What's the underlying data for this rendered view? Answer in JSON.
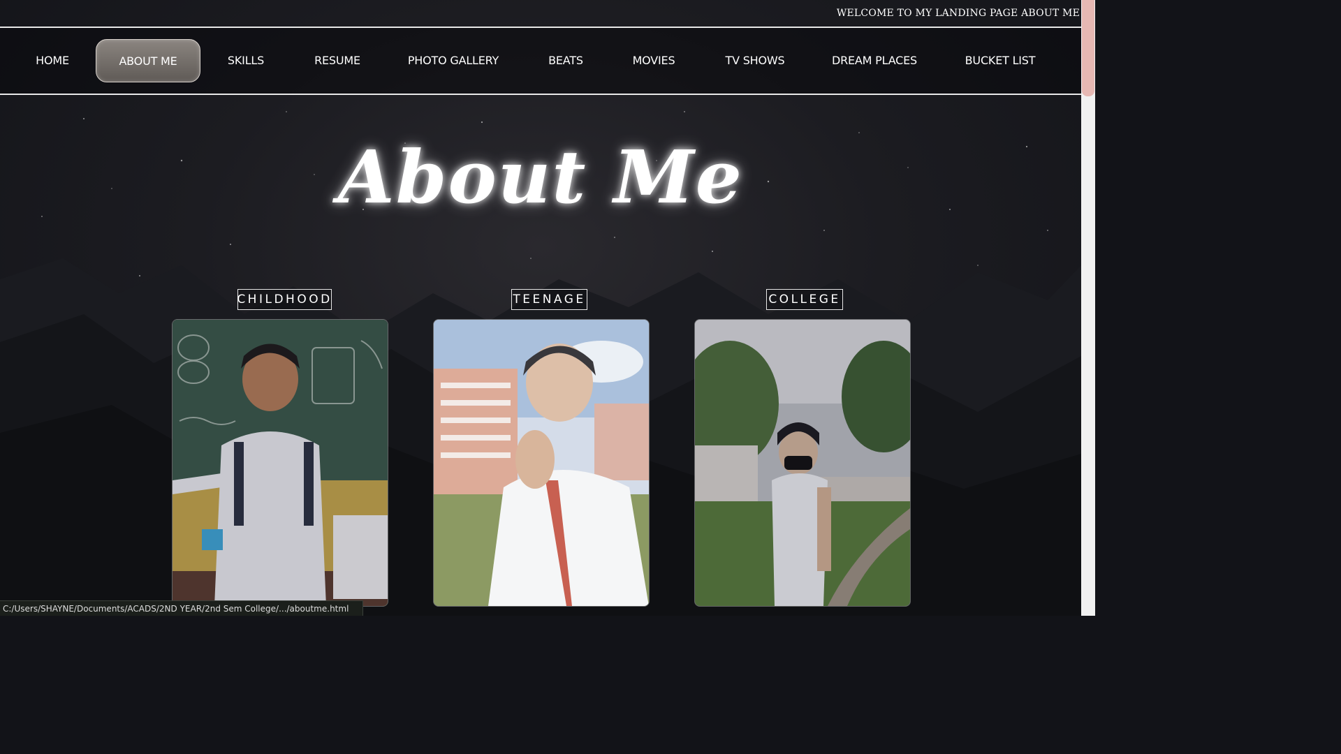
{
  "ticker": {
    "text": "WELCOME TO MY LANDING PAGE ABOUT ME"
  },
  "nav": {
    "items": [
      {
        "label": "HOME"
      },
      {
        "label": "ABOUT ME",
        "active": true
      },
      {
        "label": "SKILLS"
      },
      {
        "label": "RESUME"
      },
      {
        "label": "PHOTO GALLERY"
      },
      {
        "label": "BEATS"
      },
      {
        "label": "MOVIES"
      },
      {
        "label": "TV SHOWS"
      },
      {
        "label": "DREAM PLACES"
      },
      {
        "label": "BUCKET LIST"
      }
    ]
  },
  "main": {
    "title": "About Me",
    "cards": [
      {
        "label": "CHILDHOOD"
      },
      {
        "label": "TEENAGE"
      },
      {
        "label": "COLLEGE"
      }
    ]
  },
  "status_bar": {
    "url": "C:/Users/SHAYNE/Documents/ACADS/2ND YEAR/2nd Sem College/.../aboutme.html"
  },
  "colors": {
    "background": "#121318",
    "nav_active": "#726c67",
    "scrollbar_thumb": "#e6b8b3",
    "border": "#e9e9e9"
  }
}
